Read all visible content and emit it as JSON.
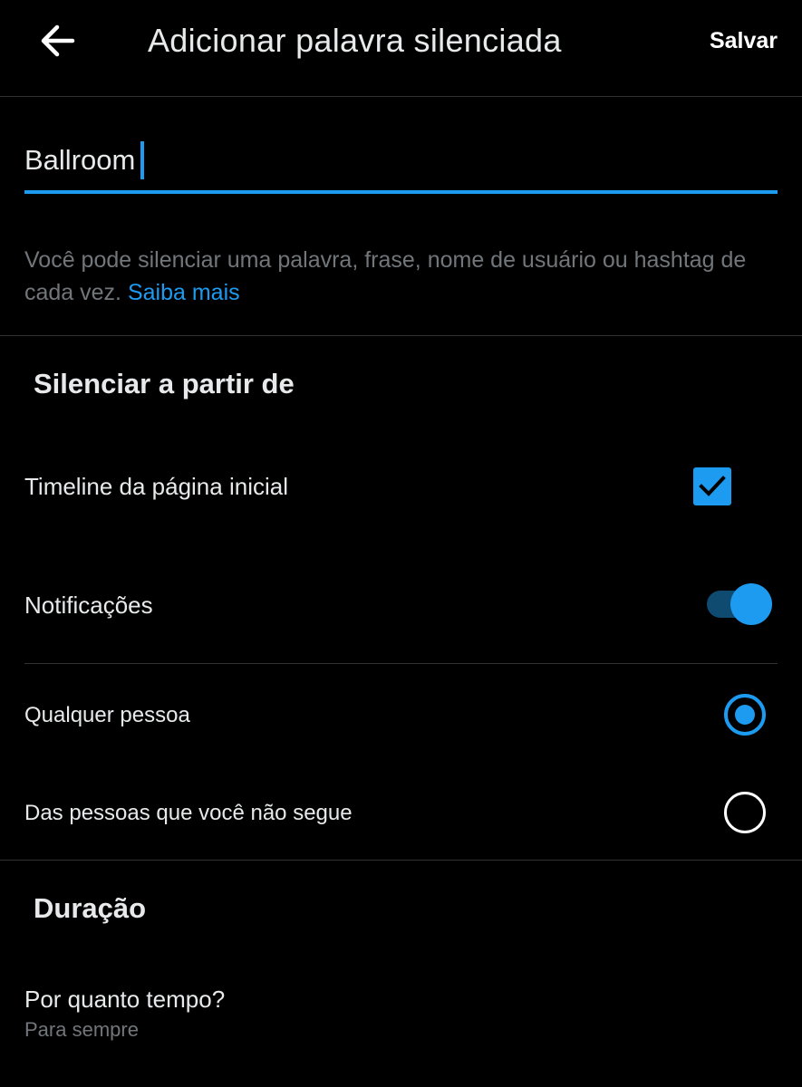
{
  "header": {
    "back_icon": "arrow-left-icon",
    "title": "Adicionar palavra silenciada",
    "save_label": "Salvar"
  },
  "word_input": {
    "value": "Ballroom",
    "accent_color": "#1d9bf0"
  },
  "helper": {
    "text": "Você pode silenciar uma palavra, frase, nome de usuário ou hashtag de cada vez.",
    "link_text": "Saiba mais"
  },
  "mute_from": {
    "title": "Silenciar a partir de",
    "home_timeline": {
      "label": "Timeline da página inicial",
      "checked": true
    },
    "notifications": {
      "label": "Notificações",
      "enabled": true
    },
    "options": [
      {
        "label": "Qualquer pessoa",
        "selected": true
      },
      {
        "label": "Das pessoas que você não segue",
        "selected": false
      }
    ]
  },
  "duration": {
    "title": "Duração",
    "question": "Por quanto tempo?",
    "value": "Para sempre"
  },
  "colors": {
    "background": "#000000",
    "accent": "#1d9bf0",
    "text": "#e7e9ea",
    "secondary_text": "#71767b",
    "divider": "#2f3336"
  }
}
